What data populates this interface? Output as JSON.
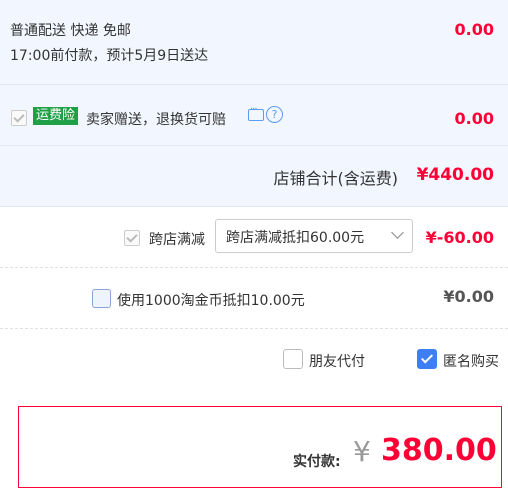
{
  "shipping": {
    "method": "普通配送 快递 免邮",
    "eta": "17:00前付款，预计5月9日送达",
    "price": "0.00"
  },
  "insurance": {
    "badge": "运费险",
    "desc": "卖家赠送，退换货可赔",
    "price": "0.00",
    "checked": true
  },
  "store_total": {
    "label": "店铺合计(含运费)",
    "value": "¥440.00"
  },
  "cross_store_discount": {
    "label": "跨店满减",
    "selected_option": "跨店满减抵扣60.00元",
    "value": "¥-60.00",
    "checked": true
  },
  "taojinbi": {
    "label": "使用1000淘金币抵扣10.00元",
    "value": "¥0.00",
    "checked": false
  },
  "options": {
    "friend_pay": {
      "label": "朋友代付",
      "checked": false
    },
    "anonymous": {
      "label": "匿名购买",
      "checked": true
    }
  },
  "payment": {
    "label": "实付款:",
    "currency": "¥",
    "amount": "380.00"
  },
  "colors": {
    "accent_red": "#ff0036",
    "insurance_green": "#20a046",
    "checkbox_blue": "#3d7ef3"
  }
}
